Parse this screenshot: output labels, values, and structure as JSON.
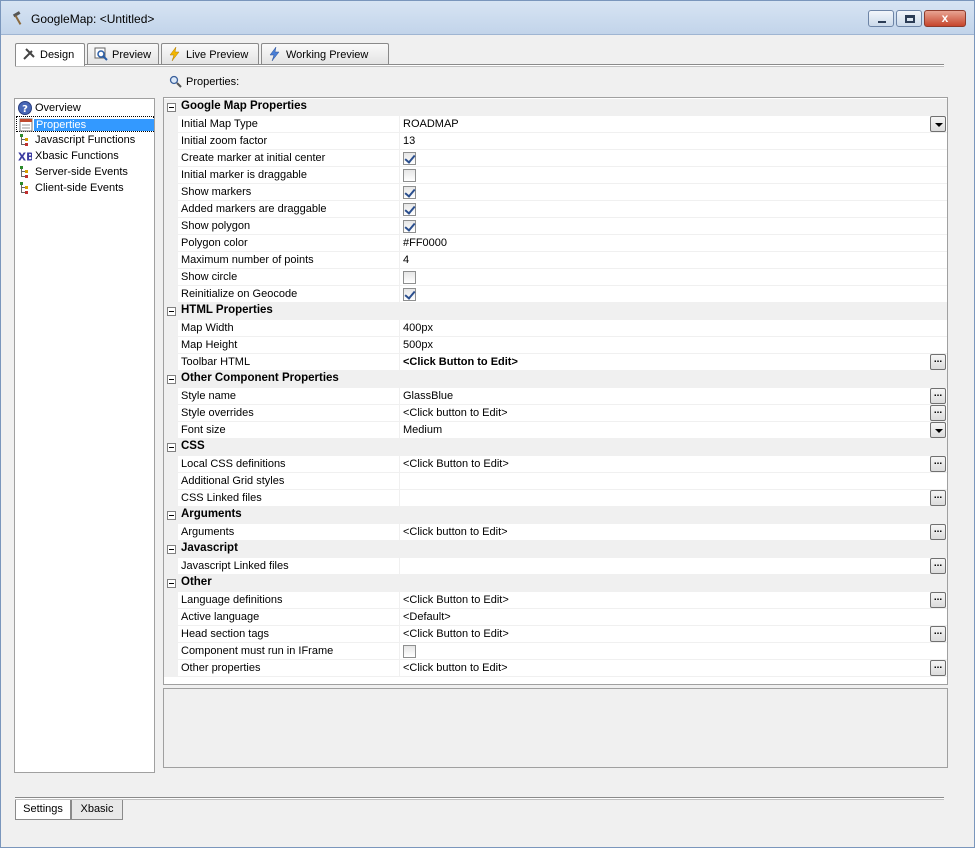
{
  "window": {
    "title": "GoogleMap: <Untitled>",
    "controls": {
      "minimize": "minimize",
      "maximize": "maximize",
      "close": "x"
    }
  },
  "tabs": [
    {
      "label": "Design",
      "icon": "design-tools-icon",
      "active": true
    },
    {
      "label": "Preview",
      "icon": "preview-magnifier-icon",
      "active": false
    },
    {
      "label": "Live Preview",
      "icon": "lightning-icon",
      "active": false
    },
    {
      "label": "Working Preview",
      "icon": "lightning-icon",
      "active": false
    }
  ],
  "properties_header": "Properties:",
  "nav": [
    {
      "label": "Overview",
      "icon": "help-circle-icon",
      "selected": false
    },
    {
      "label": "Properties",
      "icon": "properties-sheet-icon",
      "selected": true
    },
    {
      "label": "Javascript Functions",
      "icon": "tree-events-icon",
      "selected": false
    },
    {
      "label": "Xbasic Functions",
      "icon": "xb-icon",
      "selected": false
    },
    {
      "label": "Server-side Events",
      "icon": "tree-events-icon",
      "selected": false
    },
    {
      "label": "Client-side Events",
      "icon": "tree-events-icon",
      "selected": false
    }
  ],
  "grid": [
    {
      "type": "cat",
      "label": "Google Map Properties"
    },
    {
      "type": "prop",
      "name": "Initial Map Type",
      "value": "ROADMAP",
      "button": "dropdown"
    },
    {
      "type": "prop",
      "name": "Initial zoom factor",
      "value": "13"
    },
    {
      "type": "prop",
      "name": "Create marker at initial center",
      "check": true
    },
    {
      "type": "prop",
      "name": "Initial marker is draggable",
      "check": false
    },
    {
      "type": "prop",
      "name": "Show markers",
      "check": true
    },
    {
      "type": "prop",
      "name": "Added markers are draggable",
      "check": true
    },
    {
      "type": "prop",
      "name": "Show polygon",
      "check": true
    },
    {
      "type": "prop",
      "name": "Polygon color",
      "value": "#FF0000"
    },
    {
      "type": "prop",
      "name": "Maximum number of points",
      "value": "4"
    },
    {
      "type": "prop",
      "name": "Show circle",
      "check": false
    },
    {
      "type": "prop",
      "name": "Reinitialize on Geocode",
      "check": true
    },
    {
      "type": "cat",
      "label": "HTML Properties"
    },
    {
      "type": "prop",
      "name": "Map Width",
      "value": "400px"
    },
    {
      "type": "prop",
      "name": "Map Height",
      "value": "500px"
    },
    {
      "type": "prop",
      "name": "Toolbar HTML",
      "value": "<Click Button to Edit>",
      "bold": true,
      "button": "ellipsis"
    },
    {
      "type": "cat",
      "label": "Other Component Properties"
    },
    {
      "type": "prop",
      "name": "Style name",
      "value": "GlassBlue",
      "button": "ellipsis"
    },
    {
      "type": "prop",
      "name": "Style overrides",
      "value": "<Click button to Edit>",
      "button": "ellipsis"
    },
    {
      "type": "prop",
      "name": "Font size",
      "value": "Medium",
      "button": "dropdown"
    },
    {
      "type": "cat",
      "label": "CSS"
    },
    {
      "type": "prop",
      "name": "Local CSS definitions",
      "value": "<Click Button to Edit>",
      "button": "ellipsis"
    },
    {
      "type": "prop",
      "name": "Additional Grid styles",
      "value": ""
    },
    {
      "type": "prop",
      "name": "CSS Linked files",
      "value": "",
      "button": "ellipsis"
    },
    {
      "type": "cat",
      "label": "Arguments"
    },
    {
      "type": "prop",
      "name": "Arguments",
      "value": "<Click button to Edit>",
      "button": "ellipsis"
    },
    {
      "type": "cat",
      "label": "Javascript"
    },
    {
      "type": "prop",
      "name": "Javascript Linked files",
      "value": "",
      "button": "ellipsis"
    },
    {
      "type": "cat",
      "label": "Other"
    },
    {
      "type": "prop",
      "name": "Language definitions",
      "value": "<Click Button to Edit>",
      "button": "ellipsis"
    },
    {
      "type": "prop",
      "name": "Active language",
      "value": "<Default>"
    },
    {
      "type": "prop",
      "name": "Head section tags",
      "value": "<Click Button to Edit>",
      "button": "ellipsis"
    },
    {
      "type": "prop",
      "name": "Component must run in IFrame",
      "check": false
    },
    {
      "type": "prop",
      "name": "Other properties",
      "value": "<Click button to Edit>",
      "button": "ellipsis"
    }
  ],
  "ellipsis_label": "...",
  "bottom_tabs": [
    {
      "label": "Settings",
      "active": true
    },
    {
      "label": "Xbasic",
      "active": false
    }
  ]
}
